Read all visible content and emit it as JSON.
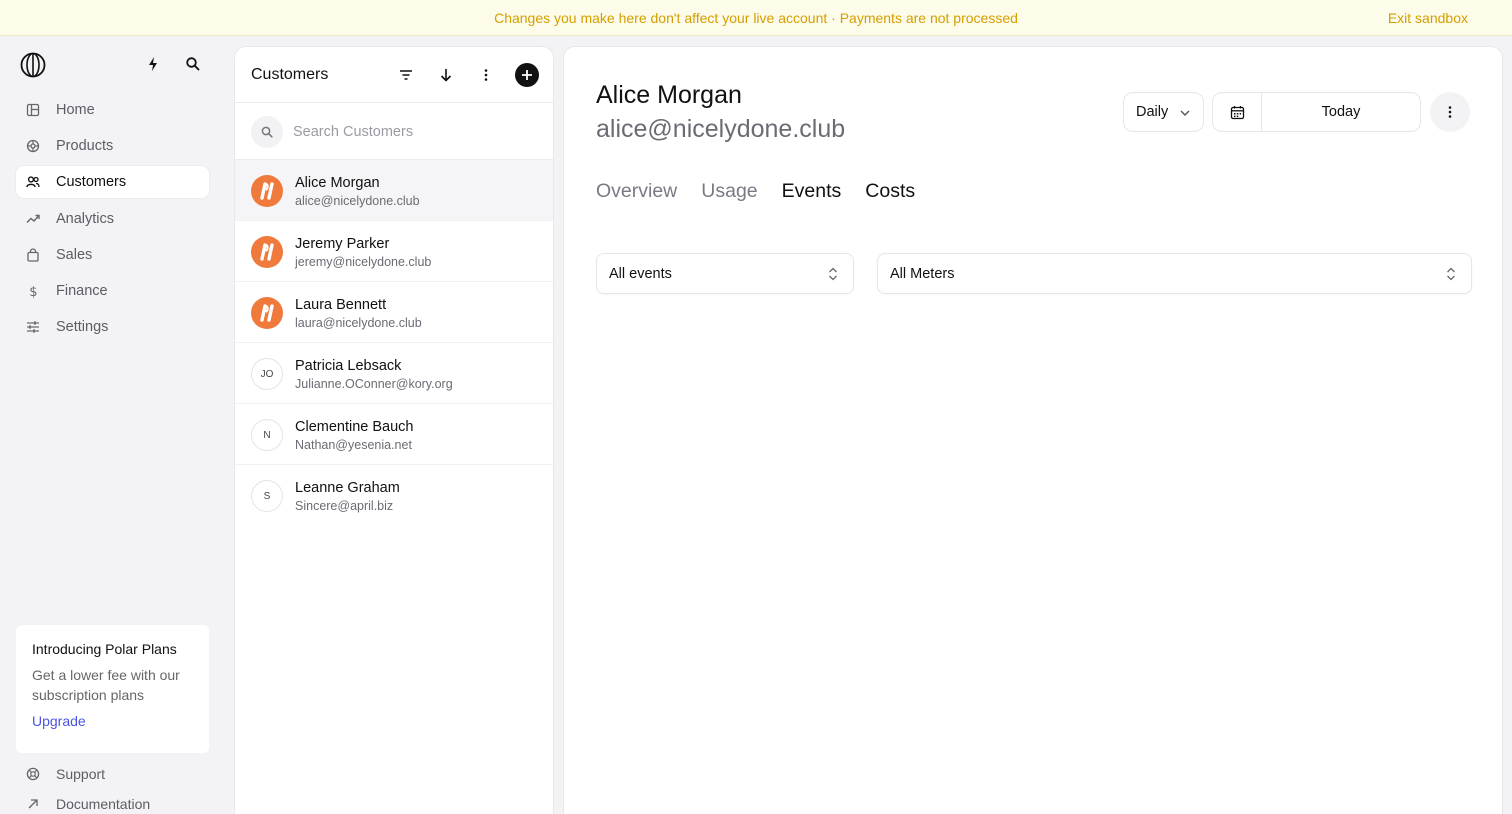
{
  "banner": {
    "message": "Changes you make here don't affect your live account · Payments are not processed",
    "exit_label": "Exit sandbox"
  },
  "sidebar": {
    "items": [
      {
        "label": "Home",
        "icon": "home-icon"
      },
      {
        "label": "Products",
        "icon": "products-icon"
      },
      {
        "label": "Customers",
        "icon": "customers-icon",
        "active": true
      },
      {
        "label": "Analytics",
        "icon": "analytics-icon"
      },
      {
        "label": "Sales",
        "icon": "sales-icon"
      },
      {
        "label": "Finance",
        "icon": "finance-icon"
      },
      {
        "label": "Settings",
        "icon": "settings-icon"
      }
    ],
    "promo": {
      "title": "Introducing Polar Plans",
      "text": "Get a lower fee with our subscription plans",
      "link": "Upgrade"
    },
    "footer": [
      {
        "label": "Support",
        "icon": "support-icon"
      },
      {
        "label": "Documentation",
        "icon": "external-link-icon"
      }
    ]
  },
  "customers_panel": {
    "title": "Customers",
    "search_placeholder": "Search Customers",
    "customers": [
      {
        "name": "Alice Morgan",
        "email": "alice@nicelydone.club",
        "avatar": "brand",
        "selected": true
      },
      {
        "name": "Jeremy Parker",
        "email": "jeremy@nicelydone.club",
        "avatar": "brand"
      },
      {
        "name": "Laura Bennett",
        "email": "laura@nicelydone.club",
        "avatar": "brand"
      },
      {
        "name": "Patricia Lebsack",
        "email": "Julianne.OConner@kory.org",
        "avatar": "initials",
        "initials": "JO"
      },
      {
        "name": "Clementine Bauch",
        "email": "Nathan@yesenia.net",
        "avatar": "initials",
        "initials": "N"
      },
      {
        "name": "Leanne Graham",
        "email": "Sincere@april.biz",
        "avatar": "initials",
        "initials": "S"
      }
    ]
  },
  "detail": {
    "name": "Alice Morgan",
    "email": "alice@nicelydone.club",
    "interval": "Daily",
    "date_label": "Today",
    "tabs": [
      "Overview",
      "Usage",
      "Events",
      "Costs"
    ],
    "events_filter": "All events",
    "meters_filter": "All Meters"
  },
  "colors": {
    "banner_text": "#d4a000",
    "banner_bg": "#fdfbe9",
    "brand_avatar": "#ef7a3b",
    "link": "#4a56e2"
  }
}
